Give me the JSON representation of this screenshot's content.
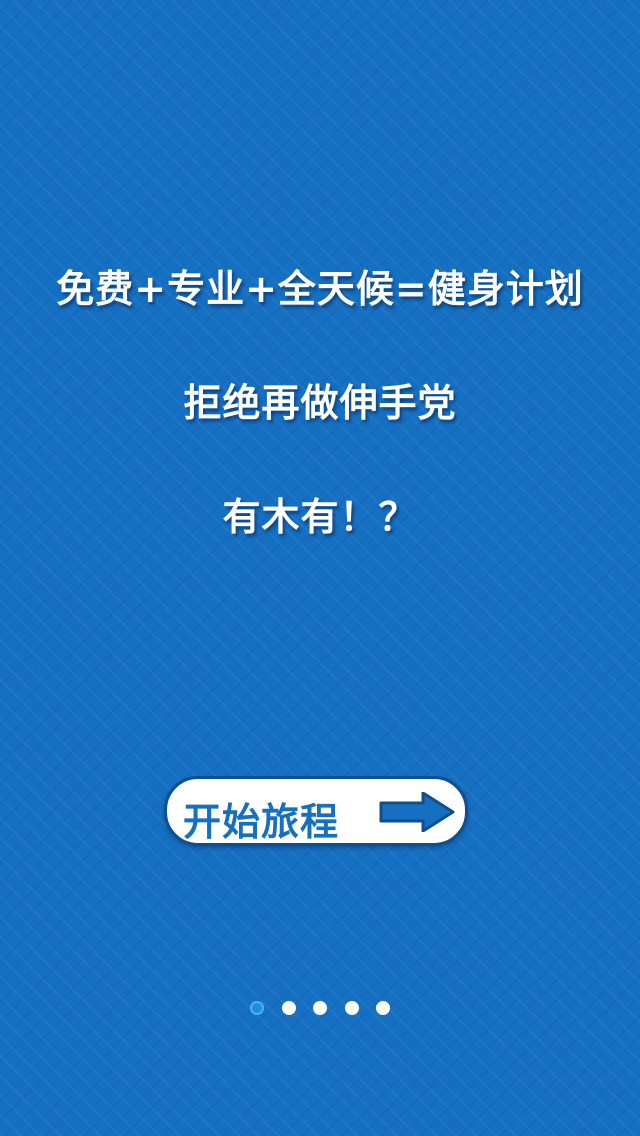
{
  "screen": {
    "background_color": "#1670C2",
    "headline_lines": [
      "免费+专业+全天候=健身计划",
      "拒绝再做伸手党",
      "有木有！？"
    ],
    "start_button": {
      "label": "开始旅程",
      "icon": "arrow-right-icon"
    },
    "pager": {
      "total": 5,
      "active_index": 0,
      "active_color": "#1A8FE0",
      "inactive_color": "#FFFFFF"
    }
  }
}
